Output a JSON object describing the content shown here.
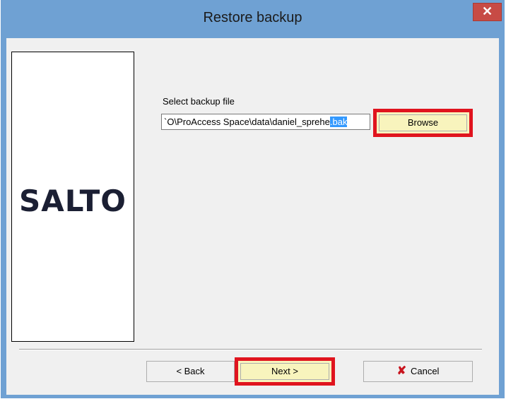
{
  "window": {
    "title": "Restore backup",
    "close_label": "✕"
  },
  "logo": {
    "text": "SALTO"
  },
  "backup": {
    "label": "Select backup file",
    "path_visible": "O\\ProAccess Space\\data\\daniel_sprehe",
    "path_selected": ".bak",
    "path_prefix_char": "`"
  },
  "buttons": {
    "browse": "Browse",
    "back": "< Back",
    "next": "Next >",
    "cancel": "Cancel"
  },
  "colors": {
    "titlebar": "#6fa1d3",
    "highlight": "#e0141e",
    "close": "#c74b45"
  }
}
